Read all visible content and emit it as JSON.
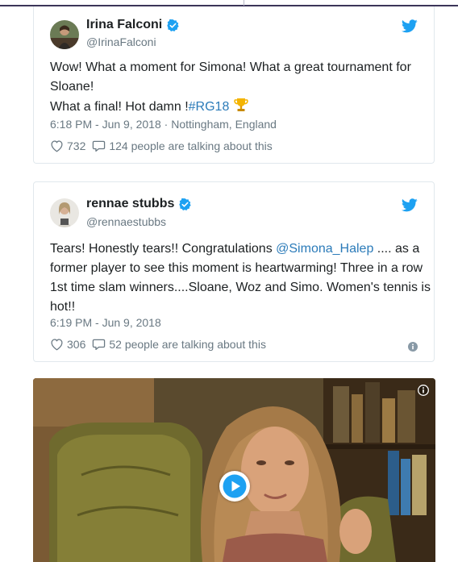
{
  "tweets": [
    {
      "name": "Irina Falconi",
      "handle": "@IrinaFalconi",
      "text_line1": "Wow! What a moment for Simona! What a great tournament for Sloane!",
      "text_line2_prefix": "What a final! Hot damn !",
      "text_hashtag": "#RG18",
      "timestamp": "6:18 PM - Jun 9, 2018",
      "separator": "·",
      "location": "Nottingham, England",
      "likes": "732",
      "talking": "124 people are talking about this"
    },
    {
      "name": "rennae stubbs",
      "handle": "@rennaestubbs",
      "text_prefix": "Tears! Honestly tears!! Congratulations ",
      "text_mention": "@Simona_Halep",
      "text_suffix": " .... as a former player to see this moment is heartwarming! Three in a row 1st time slam winners....Sloane, Woz and Simo. Women's tennis is hot!!",
      "timestamp": "6:19 PM - Jun 9, 2018",
      "likes": "306",
      "talking": "52 people are talking about this"
    }
  ],
  "colors": {
    "link": "#2b7bb9",
    "verified": "#1da1f2",
    "muted": "#697882",
    "top_rule": "#3b3559"
  },
  "icons": [
    "verified-badge-icon",
    "twitter-bird-icon",
    "heart-icon",
    "comment-icon",
    "info-icon",
    "trophy-icon",
    "play-icon"
  ]
}
